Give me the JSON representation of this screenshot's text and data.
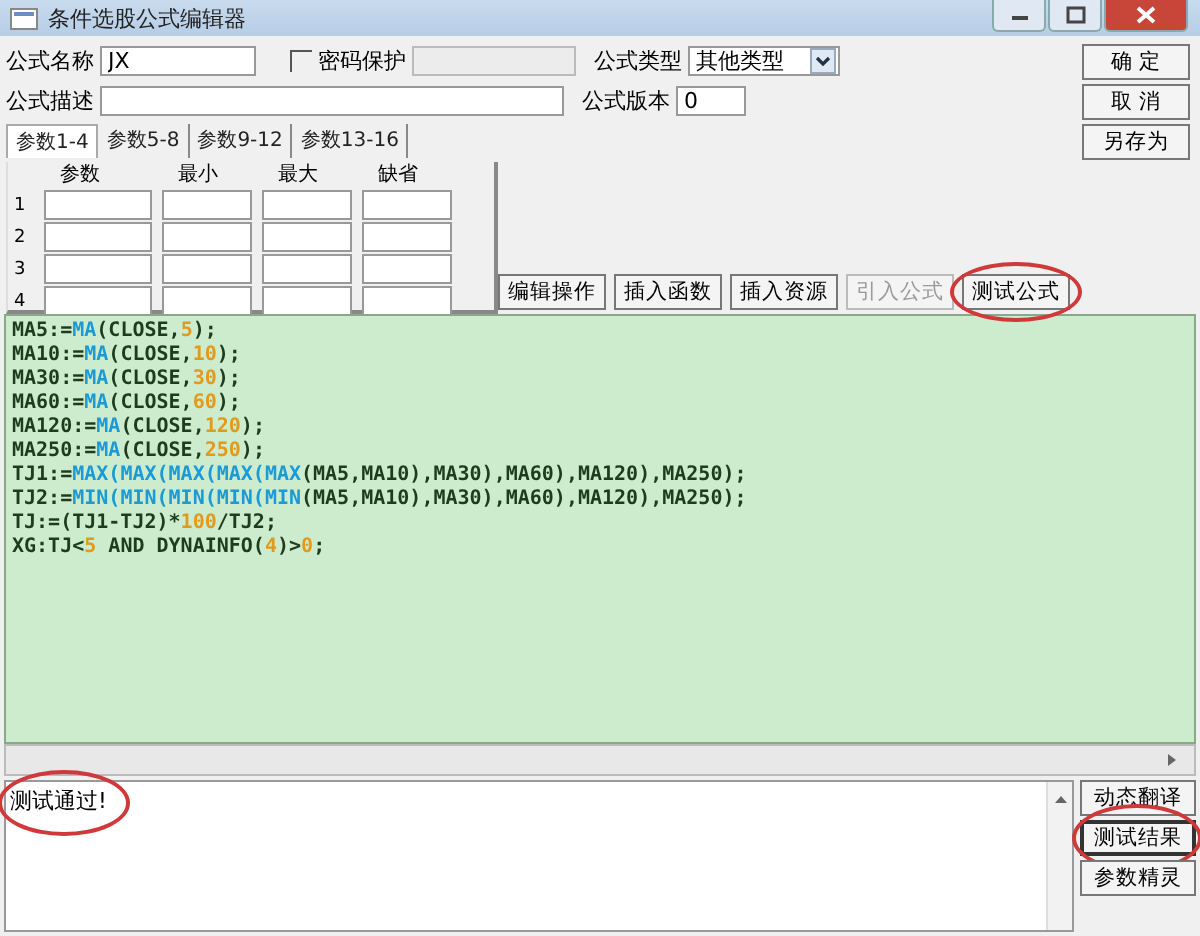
{
  "window": {
    "title": "条件选股公式编辑器"
  },
  "form": {
    "name_label": "公式名称",
    "name_value": "JX",
    "password": {
      "label": "密码保护",
      "checked": false
    },
    "type_label": "公式类型",
    "type_value": "其他类型",
    "desc_label": "公式描述",
    "version_label": "公式版本",
    "version_value": "0"
  },
  "side_buttons": [
    {
      "label": "确  定"
    },
    {
      "label": "取  消"
    },
    {
      "label": "另存为"
    }
  ],
  "tabs": [
    {
      "label": "参数1-4",
      "selected": true
    },
    {
      "label": "参数5-8",
      "selected": false
    },
    {
      "label": "参数9-12",
      "selected": false
    },
    {
      "label": "参数13-16",
      "selected": false
    }
  ],
  "param_columns": [
    "参数",
    "最小",
    "最大",
    "缺省"
  ],
  "param_rows": [
    "1",
    "2",
    "3",
    "4"
  ],
  "action_buttons": [
    {
      "label": "编辑操作",
      "disabled": false,
      "circled": false
    },
    {
      "label": "插入函数",
      "disabled": false,
      "circled": false
    },
    {
      "label": "插入资源",
      "disabled": false,
      "circled": false
    },
    {
      "label": "引入公式",
      "disabled": true,
      "circled": false
    },
    {
      "label": "测试公式",
      "disabled": false,
      "circled": true
    }
  ],
  "code_lines": [
    [
      {
        "kind": "plain",
        "text": "MA5:="
      },
      {
        "kind": "func",
        "text": "MA"
      },
      {
        "kind": "plain",
        "text": "(CLOSE,"
      },
      {
        "kind": "num",
        "text": "5"
      },
      {
        "kind": "plain",
        "text": ");"
      }
    ],
    [
      {
        "kind": "plain",
        "text": "MA10:="
      },
      {
        "kind": "func",
        "text": "MA"
      },
      {
        "kind": "plain",
        "text": "(CLOSE,"
      },
      {
        "kind": "num",
        "text": "10"
      },
      {
        "kind": "plain",
        "text": ");"
      }
    ],
    [
      {
        "kind": "plain",
        "text": "MA30:="
      },
      {
        "kind": "func",
        "text": "MA"
      },
      {
        "kind": "plain",
        "text": "(CLOSE,"
      },
      {
        "kind": "num",
        "text": "30"
      },
      {
        "kind": "plain",
        "text": ");"
      }
    ],
    [
      {
        "kind": "plain",
        "text": "MA60:="
      },
      {
        "kind": "func",
        "text": "MA"
      },
      {
        "kind": "plain",
        "text": "(CLOSE,"
      },
      {
        "kind": "num",
        "text": "60"
      },
      {
        "kind": "plain",
        "text": ");"
      }
    ],
    [
      {
        "kind": "plain",
        "text": "MA120:="
      },
      {
        "kind": "func",
        "text": "MA"
      },
      {
        "kind": "plain",
        "text": "(CLOSE,"
      },
      {
        "kind": "num",
        "text": "120"
      },
      {
        "kind": "plain",
        "text": ");"
      }
    ],
    [
      {
        "kind": "plain",
        "text": "MA250:="
      },
      {
        "kind": "func",
        "text": "MA"
      },
      {
        "kind": "plain",
        "text": "(CLOSE,"
      },
      {
        "kind": "num",
        "text": "250"
      },
      {
        "kind": "plain",
        "text": ");"
      }
    ],
    [
      {
        "kind": "plain",
        "text": "TJ1:="
      },
      {
        "kind": "func",
        "text": "MAX(MAX(MAX(MAX(MAX"
      },
      {
        "kind": "plain",
        "text": "(MA5,MA10),MA30),MA60),MA120),MA250);"
      }
    ],
    [
      {
        "kind": "plain",
        "text": "TJ2:="
      },
      {
        "kind": "func",
        "text": "MIN(MIN(MIN(MIN(MIN"
      },
      {
        "kind": "plain",
        "text": "(MA5,MA10),MA30),MA60),MA120),MA250);"
      }
    ],
    [
      {
        "kind": "plain",
        "text": "TJ:=(TJ1-TJ2)*"
      },
      {
        "kind": "num",
        "text": "100"
      },
      {
        "kind": "plain",
        "text": "/TJ2;"
      }
    ],
    [
      {
        "kind": "plain",
        "text": "XG:TJ<"
      },
      {
        "kind": "num",
        "text": "5"
      },
      {
        "kind": "plain",
        "text": " AND DYNAINFO("
      },
      {
        "kind": "num",
        "text": "4"
      },
      {
        "kind": "plain",
        "text": ")>"
      },
      {
        "kind": "num",
        "text": "0"
      },
      {
        "kind": "plain",
        "text": ";"
      }
    ]
  ],
  "output": {
    "message": "测试通过!",
    "circled": true
  },
  "result_buttons": [
    {
      "label": "动态翻译",
      "circled": false
    },
    {
      "label": "测试结果",
      "circled": true
    },
    {
      "label": "参数精灵",
      "circled": false
    }
  ]
}
